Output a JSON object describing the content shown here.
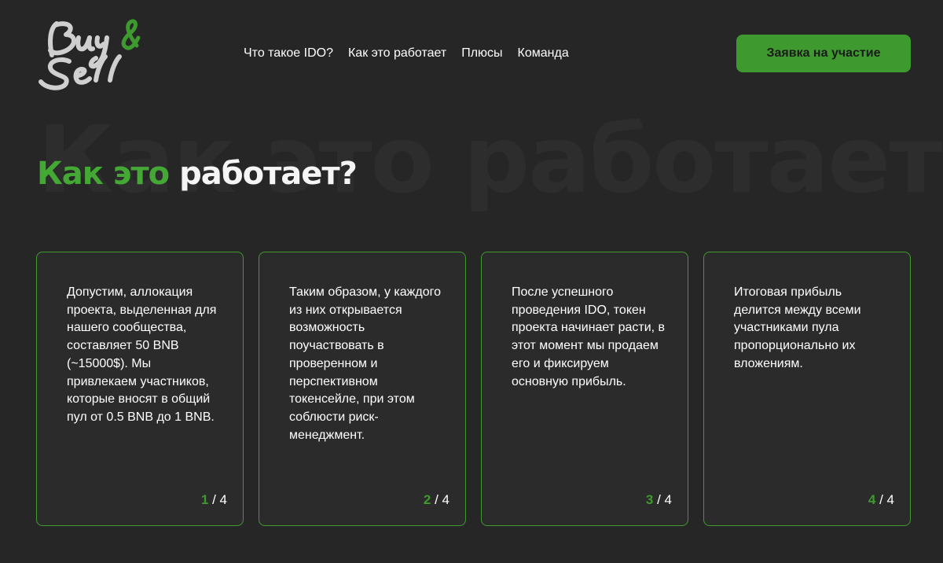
{
  "header": {
    "logo_text": "Buy & Sell",
    "nav": [
      {
        "label": "Что такое IDO?"
      },
      {
        "label": "Как это работает"
      },
      {
        "label": "Плюсы"
      },
      {
        "label": "Команда"
      }
    ],
    "cta_label": "Заявка на участие"
  },
  "section": {
    "background_title": "Как это работает?",
    "title_accent": "Как это",
    "title_rest": "работает?"
  },
  "cards": [
    {
      "text": "Допустим, аллокация проекта, выделенная для нашего сообщества, составляет 50 BNB (~15000$). Мы привлекаем участников, которые вносят в общий пул от 0.5 BNB до 1 BNB.",
      "number": "1",
      "separator": " / ",
      "total": "4"
    },
    {
      "text": "Таким образом, у каждого из них открывается возможность поучаствовать в проверенном и перспективном токенсейле, при этом соблюсти риск-менеджмент.",
      "number": "2",
      "separator": " / ",
      "total": "4"
    },
    {
      "text": "После успешного проведения IDO, токен проекта начинает расти, в этот момент мы продаем его и фиксируем основную прибыль.",
      "number": "3",
      "separator": " / ",
      "total": "4"
    },
    {
      "text": "Итоговая прибыль делится между всеми участниками пула пропорционально их вложениям.",
      "number": "4",
      "separator": " / ",
      "total": "4"
    }
  ],
  "colors": {
    "background": "#262626",
    "accent": "#3e9a2f",
    "card_border": "#3f9a2f"
  }
}
